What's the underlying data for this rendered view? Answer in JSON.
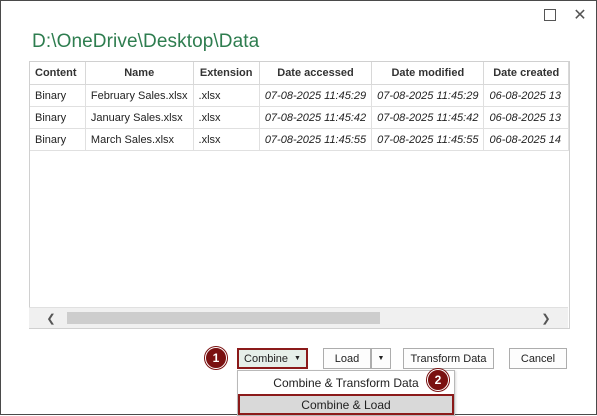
{
  "window": {
    "maximize_icon": "maximize-icon",
    "close_icon": "close-icon",
    "close_glyph": "✕"
  },
  "path_title": "D:\\OneDrive\\Desktop\\Data",
  "table": {
    "columns": [
      "Content",
      "Name",
      "Extension",
      "Date accessed",
      "Date modified",
      "Date created"
    ],
    "rows": [
      [
        "Binary",
        "February Sales.xlsx",
        ".xlsx",
        "07-08-2025 11:45:29",
        "07-08-2025 11:45:29",
        "06-08-2025 13"
      ],
      [
        "Binary",
        "January Sales.xlsx",
        ".xlsx",
        "07-08-2025 11:45:42",
        "07-08-2025 11:45:42",
        "06-08-2025 13"
      ],
      [
        "Binary",
        "March Sales.xlsx",
        ".xlsx",
        "07-08-2025 11:45:55",
        "07-08-2025 11:45:55",
        "06-08-2025 14"
      ]
    ]
  },
  "scrollbar": {
    "left_glyph": "❮",
    "right_glyph": "❯"
  },
  "buttons": {
    "combine": "Combine",
    "combine_caret": "▼",
    "load": "Load",
    "load_caret": "▼",
    "transform": "Transform Data",
    "cancel": "Cancel"
  },
  "badges": {
    "first": "1",
    "second": "2"
  },
  "combine_menu": {
    "items": [
      "Combine & Transform Data",
      "Combine & Load"
    ]
  },
  "colors": {
    "title_green": "#2e7d4f",
    "highlight": "#8b1a1a"
  }
}
